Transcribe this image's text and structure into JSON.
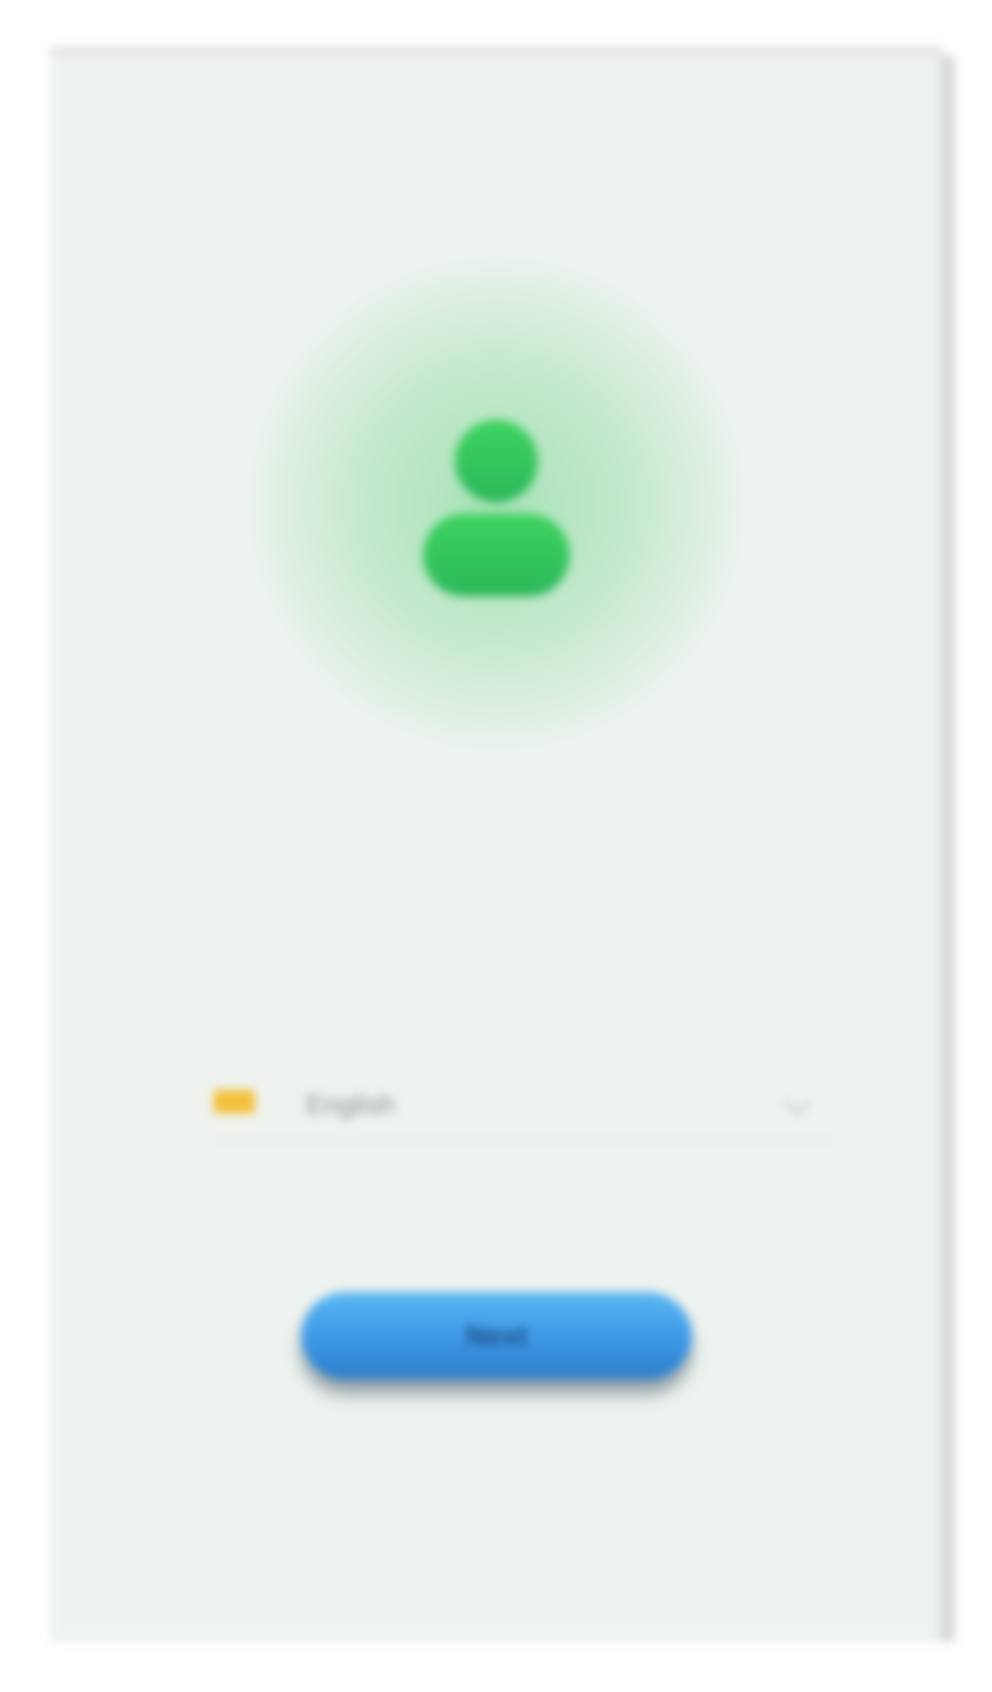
{
  "avatar": {
    "icon": "person-icon",
    "accent": "#34c759"
  },
  "header": {
    "title": "",
    "subtitle": ""
  },
  "language": {
    "flag_icon": "flag-icon",
    "value": "English",
    "dropdown_icon": "chevron-down-icon"
  },
  "actions": {
    "next_label": "Next",
    "button_color": "#3b97e6"
  }
}
